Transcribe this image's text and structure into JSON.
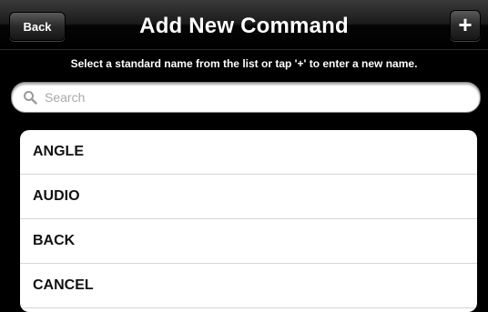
{
  "navbar": {
    "back_label": "Back",
    "title": "Add New Command",
    "add_label": "+"
  },
  "instruction": "Select a standard name from the list or tap '+' to enter a new name.",
  "search": {
    "placeholder": "Search",
    "value": "",
    "icon": "magnifier-icon"
  },
  "commands": [
    {
      "label": "ANGLE"
    },
    {
      "label": "AUDIO"
    },
    {
      "label": "BACK"
    },
    {
      "label": "CANCEL"
    }
  ],
  "colors": {
    "navbar_background": "#1b1b1b",
    "page_background": "#000000",
    "list_background": "#ffffff",
    "separator": "#d6d6d6"
  }
}
